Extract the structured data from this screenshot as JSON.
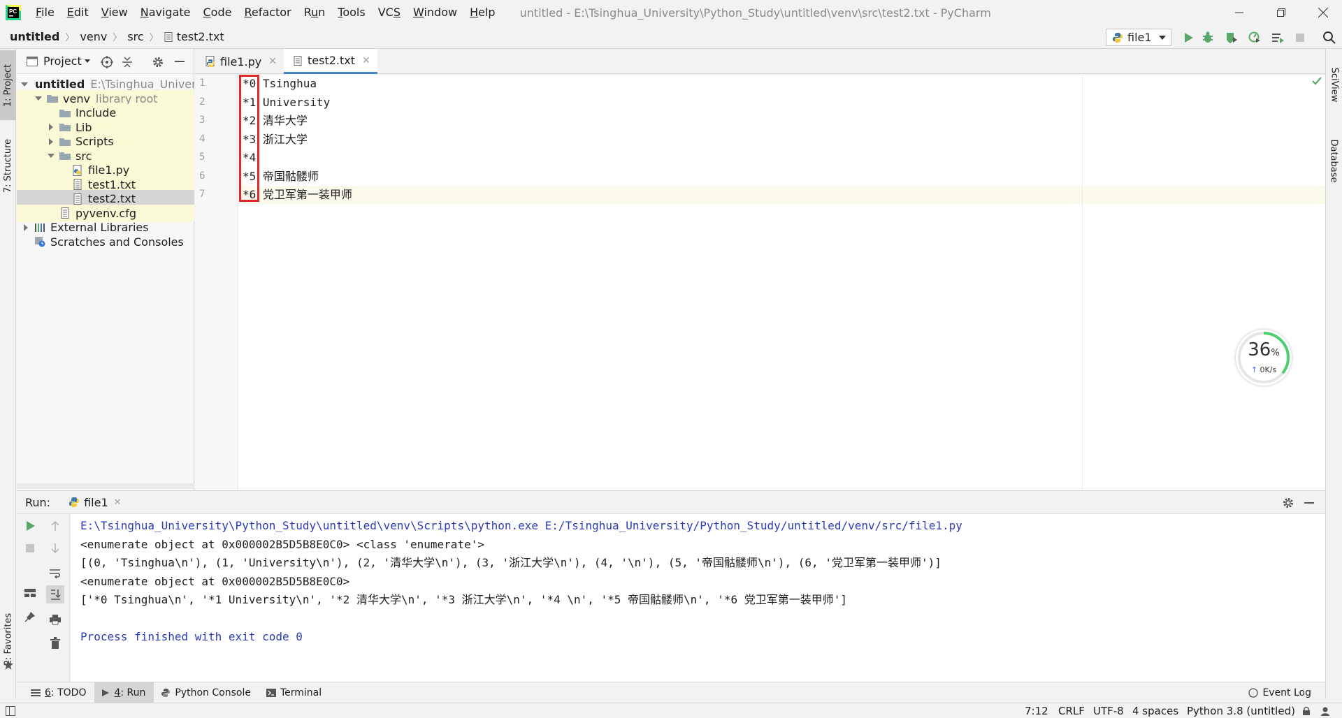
{
  "window": {
    "title": "untitled - E:\\Tsinghua_University\\Python_Study\\untitled\\venv\\src\\test2.txt - PyCharm"
  },
  "menu": [
    {
      "label": "File",
      "mnemonic": "F"
    },
    {
      "label": "Edit",
      "mnemonic": "E"
    },
    {
      "label": "View",
      "mnemonic": "V"
    },
    {
      "label": "Navigate",
      "mnemonic": "N"
    },
    {
      "label": "Code",
      "mnemonic": "C"
    },
    {
      "label": "Refactor",
      "mnemonic": "R"
    },
    {
      "label": "Run",
      "mnemonic": "u"
    },
    {
      "label": "Tools",
      "mnemonic": "T"
    },
    {
      "label": "VCS",
      "mnemonic": "S"
    },
    {
      "label": "Window",
      "mnemonic": "W"
    },
    {
      "label": "Help",
      "mnemonic": "H"
    }
  ],
  "breadcrumb": [
    "untitled",
    "venv",
    "src",
    "test2.txt"
  ],
  "run_config": "file1",
  "left_stripe": {
    "project": "1: Project",
    "structure": "7: Structure",
    "favorites": "2: Favorites"
  },
  "right_stripe": {
    "sciview": "SciView",
    "database": "Database"
  },
  "project_panel": {
    "title": "Project",
    "tree": [
      {
        "label": "untitled",
        "hint": "E:\\Tsinghua_Univer",
        "type": "folder",
        "depth": 0,
        "expanded": true,
        "bold": true
      },
      {
        "label": "venv",
        "hint": "library root",
        "type": "folder",
        "depth": 1,
        "expanded": true
      },
      {
        "label": "Include",
        "hint": "",
        "type": "folder",
        "depth": 2,
        "expanded": null
      },
      {
        "label": "Lib",
        "hint": "",
        "type": "folder",
        "depth": 2,
        "expanded": false
      },
      {
        "label": "Scripts",
        "hint": "",
        "type": "folder",
        "depth": 2,
        "expanded": false
      },
      {
        "label": "src",
        "hint": "",
        "type": "folder",
        "depth": 2,
        "expanded": true
      },
      {
        "label": "file1.py",
        "hint": "",
        "type": "py",
        "depth": 3,
        "expanded": null
      },
      {
        "label": "test1.txt",
        "hint": "",
        "type": "txt",
        "depth": 3,
        "expanded": null
      },
      {
        "label": "test2.txt",
        "hint": "",
        "type": "txt",
        "depth": 3,
        "expanded": null,
        "selected": true
      },
      {
        "label": "pyvenv.cfg",
        "hint": "",
        "type": "cfg",
        "depth": 2,
        "expanded": null
      },
      {
        "label": "External Libraries",
        "hint": "",
        "type": "lib",
        "depth": 0,
        "expanded": false
      },
      {
        "label": "Scratches and Consoles",
        "hint": "",
        "type": "scratch",
        "depth": 0,
        "expanded": null
      }
    ]
  },
  "editor": {
    "tabs": [
      {
        "label": "file1.py",
        "type": "py",
        "active": false
      },
      {
        "label": "test2.txt",
        "type": "txt",
        "active": true
      }
    ],
    "lines": [
      {
        "num": "1",
        "text": "*0 Tsinghua"
      },
      {
        "num": "2",
        "text": "*1 University"
      },
      {
        "num": "3",
        "text": "*2 清华大学"
      },
      {
        "num": "4",
        "text": "*3 浙江大学"
      },
      {
        "num": "5",
        "text": "*4"
      },
      {
        "num": "6",
        "text": "*5 帝国骷髅师"
      },
      {
        "num": "7",
        "text": "*6 党卫军第一装甲师"
      }
    ],
    "current_line": 7
  },
  "run_panel": {
    "label": "Run:",
    "tab": "file1",
    "output": [
      {
        "text": "E:\\Tsinghua_University\\Python_Study\\untitled\\venv\\Scripts\\python.exe E:/Tsinghua_University/Python_Study/untitled/venv/src/file1.py",
        "style": "blue"
      },
      {
        "text": "<enumerate object at 0x000002B5D5B8E0C0> <class 'enumerate'>",
        "style": "normal"
      },
      {
        "text": "[(0, 'Tsinghua\\n'), (1, 'University\\n'), (2, '清华大学\\n'), (3, '浙江大学\\n'), (4, '\\n'), (5, '帝国骷髅师\\n'), (6, '党卫军第一装甲师')]",
        "style": "normal"
      },
      {
        "text": "<enumerate object at 0x000002B5D5B8E0C0>",
        "style": "normal"
      },
      {
        "text": "['*0 Tsinghua\\n', '*1 University\\n', '*2 清华大学\\n', '*3 浙江大学\\n', '*4 \\n', '*5 帝国骷髅师\\n', '*6 党卫军第一装甲师']",
        "style": "normal"
      },
      {
        "text": "",
        "style": "normal"
      },
      {
        "text": "Process finished with exit code 0",
        "style": "blue"
      }
    ]
  },
  "bottom_tabs": [
    {
      "num": "6",
      "label": ": TODO",
      "active": false
    },
    {
      "num": "4",
      "label": ": Run",
      "active": true
    },
    {
      "num": "",
      "label": "Python Console",
      "active": false
    },
    {
      "num": "",
      "label": "Terminal",
      "active": false
    }
  ],
  "event_log": "Event Log",
  "status": {
    "position": "7:12",
    "line_sep": "CRLF",
    "encoding": "UTF-8",
    "indent": "4 spaces",
    "interpreter": "Python 3.8 (untitled)"
  },
  "speed_widget": {
    "percent": "36",
    "percent_sign": "%",
    "rate": "0K/s"
  },
  "colors": {
    "accent": "#4a86c7",
    "run_green": "#59a869",
    "highlight_box": "#e0282a",
    "console_blue": "#2a3cb8"
  }
}
